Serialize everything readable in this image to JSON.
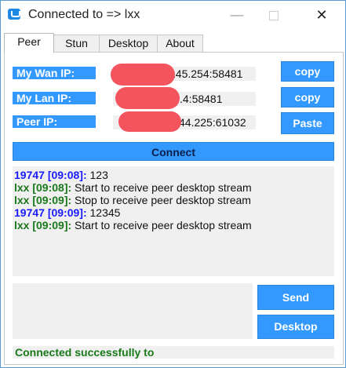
{
  "window": {
    "title": "Connected to => lxx",
    "min_glyph": "—",
    "close_glyph": "✕"
  },
  "tabs": [
    {
      "label": "Peer",
      "active": true
    },
    {
      "label": "Stun",
      "active": false
    },
    {
      "label": "Desktop",
      "active": false
    },
    {
      "label": "About",
      "active": false
    }
  ],
  "peer": {
    "wan_label": "My Wan IP:",
    "wan_value": "145.254:58481",
    "lan_label": "My Lan IP:",
    "lan_value": ".4:58481",
    "peer_label": "Peer IP:",
    "peer_value": "44.225:61032",
    "copy_wan_label": "copy",
    "copy_lan_label": "copy",
    "paste_label": "Paste",
    "connect_label": "Connect"
  },
  "log": [
    {
      "who": "19747 [09:08]:",
      "text": " 123",
      "color": "blue"
    },
    {
      "who": "lxx [09:08]:",
      "text": " Start to receive peer desktop stream",
      "color": "green"
    },
    {
      "who": "lxx [09:09]:",
      "text": " Stop to receive peer desktop stream",
      "color": "green"
    },
    {
      "who": "19747 [09:09]:",
      "text": " 12345",
      "color": "blue"
    },
    {
      "who": "lxx [09:09]:",
      "text": " Start to receive peer desktop stream",
      "color": "green"
    }
  ],
  "actions": {
    "send_label": "Send",
    "desktop_label": "Desktop"
  },
  "status_text": "Connected successfully to",
  "colors": {
    "accent": "#3399ff",
    "redaction": "#f3545e",
    "sender_blue": "#1a1aff",
    "sender_green": "#1a7a1a"
  }
}
